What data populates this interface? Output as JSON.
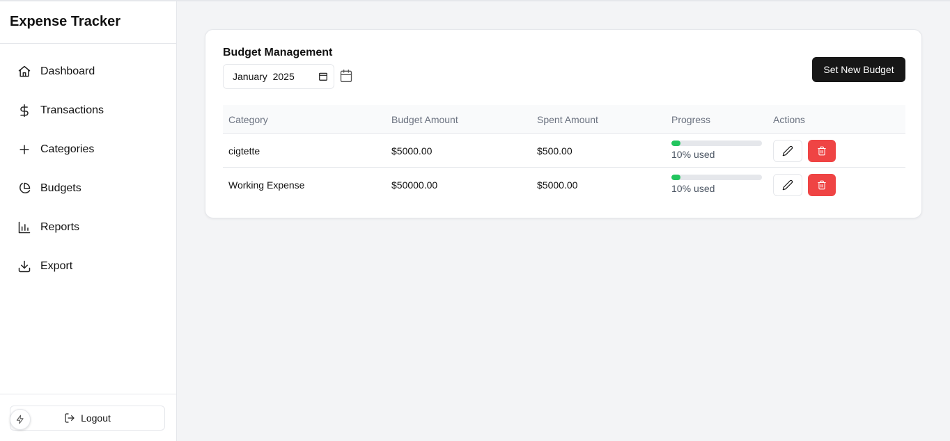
{
  "app": {
    "title": "Expense Tracker"
  },
  "sidebar": {
    "items": [
      {
        "label": "Dashboard",
        "icon": "home-icon"
      },
      {
        "label": "Transactions",
        "icon": "dollar-icon"
      },
      {
        "label": "Categories",
        "icon": "plus-icon"
      },
      {
        "label": "Budgets",
        "icon": "pie-chart-icon"
      },
      {
        "label": "Reports",
        "icon": "bar-chart-icon"
      },
      {
        "label": "Export",
        "icon": "download-icon"
      }
    ],
    "logout_label": "Logout"
  },
  "budget": {
    "title": "Budget Management",
    "month_value": "January  2025",
    "new_budget_label": "Set New Budget",
    "columns": [
      "Category",
      "Budget Amount",
      "Spent Amount",
      "Progress",
      "Actions"
    ],
    "rows": [
      {
        "category": "cigtette",
        "budget": "$5000.00",
        "spent": "$500.00",
        "progress": 0.1,
        "percent_label": "10%",
        "used_label": "used"
      },
      {
        "category": "Working Expense",
        "budget": "$50000.00",
        "spent": "$5000.00",
        "progress": 0.1,
        "percent_label": "10%",
        "used_label": "used"
      }
    ]
  },
  "colors": {
    "accent": "#171717",
    "progress_fill": "#22c55e",
    "danger": "#ef4444"
  }
}
